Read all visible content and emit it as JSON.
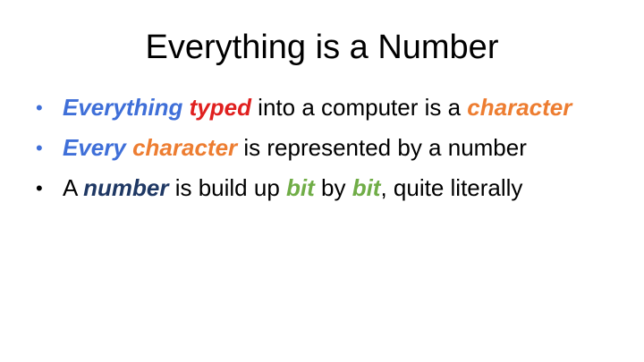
{
  "slide": {
    "title": "Everything is a Number",
    "colors": {
      "bullet_blue": "#3f6fd8",
      "red": "#e0201f",
      "orange": "#ed7d31",
      "dark_blue": "#1f3864",
      "green": "#70ad47",
      "text": "#000000"
    },
    "bullets": [
      {
        "marker": "•",
        "segments": [
          {
            "text": "Everything",
            "style": "em",
            "color": "#3f6fd8"
          },
          {
            "text": " ",
            "style": "normal",
            "color": "#000000"
          },
          {
            "text": "typed",
            "style": "em",
            "color": "#e0201f"
          },
          {
            "text": " into a computer is a ",
            "style": "normal",
            "color": "#000000"
          },
          {
            "text": "character",
            "style": "em",
            "color": "#ed7d31"
          }
        ]
      },
      {
        "marker": "•",
        "segments": [
          {
            "text": "Every",
            "style": "em",
            "color": "#3f6fd8"
          },
          {
            "text": " ",
            "style": "normal",
            "color": "#000000"
          },
          {
            "text": "character",
            "style": "em",
            "color": "#ed7d31"
          },
          {
            "text": " is represented by a number",
            "style": "normal",
            "color": "#000000"
          }
        ]
      },
      {
        "marker": "•",
        "segments": [
          {
            "text": "A ",
            "style": "normal",
            "color": "#000000"
          },
          {
            "text": "number",
            "style": "em",
            "color": "#1f3864"
          },
          {
            "text": " is build up ",
            "style": "normal",
            "color": "#000000"
          },
          {
            "text": "bit",
            "style": "em",
            "color": "#70ad47"
          },
          {
            "text": " by ",
            "style": "normal",
            "color": "#000000"
          },
          {
            "text": "bit",
            "style": "em",
            "color": "#70ad47"
          },
          {
            "text": ", quite literally",
            "style": "normal",
            "color": "#000000"
          }
        ]
      }
    ]
  }
}
